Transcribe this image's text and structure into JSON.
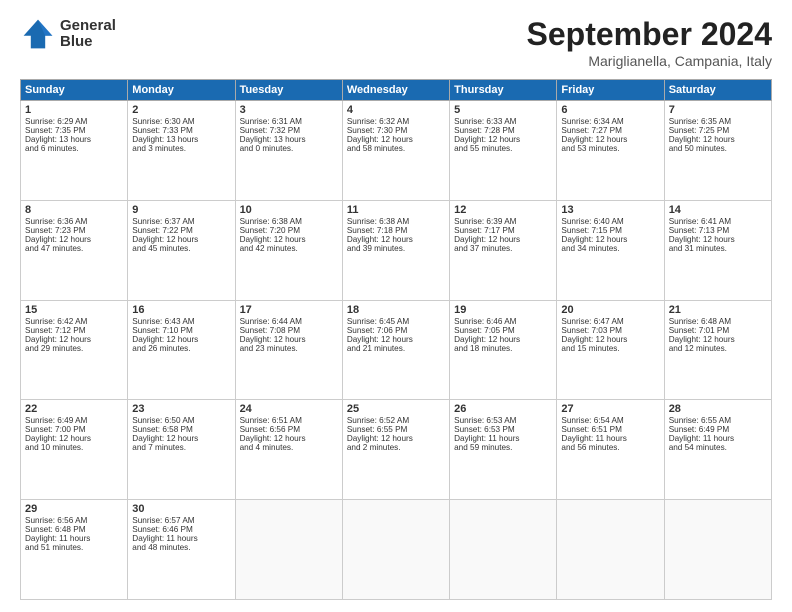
{
  "logo": {
    "line1": "General",
    "line2": "Blue"
  },
  "title": "September 2024",
  "location": "Mariglianella, Campania, Italy",
  "weekdays": [
    "Sunday",
    "Monday",
    "Tuesday",
    "Wednesday",
    "Thursday",
    "Friday",
    "Saturday"
  ],
  "weeks": [
    [
      {
        "day": "1",
        "info": "Sunrise: 6:29 AM\nSunset: 7:35 PM\nDaylight: 13 hours\nand 6 minutes."
      },
      {
        "day": "2",
        "info": "Sunrise: 6:30 AM\nSunset: 7:33 PM\nDaylight: 13 hours\nand 3 minutes."
      },
      {
        "day": "3",
        "info": "Sunrise: 6:31 AM\nSunset: 7:32 PM\nDaylight: 13 hours\nand 0 minutes."
      },
      {
        "day": "4",
        "info": "Sunrise: 6:32 AM\nSunset: 7:30 PM\nDaylight: 12 hours\nand 58 minutes."
      },
      {
        "day": "5",
        "info": "Sunrise: 6:33 AM\nSunset: 7:28 PM\nDaylight: 12 hours\nand 55 minutes."
      },
      {
        "day": "6",
        "info": "Sunrise: 6:34 AM\nSunset: 7:27 PM\nDaylight: 12 hours\nand 53 minutes."
      },
      {
        "day": "7",
        "info": "Sunrise: 6:35 AM\nSunset: 7:25 PM\nDaylight: 12 hours\nand 50 minutes."
      }
    ],
    [
      {
        "day": "8",
        "info": "Sunrise: 6:36 AM\nSunset: 7:23 PM\nDaylight: 12 hours\nand 47 minutes."
      },
      {
        "day": "9",
        "info": "Sunrise: 6:37 AM\nSunset: 7:22 PM\nDaylight: 12 hours\nand 45 minutes."
      },
      {
        "day": "10",
        "info": "Sunrise: 6:38 AM\nSunset: 7:20 PM\nDaylight: 12 hours\nand 42 minutes."
      },
      {
        "day": "11",
        "info": "Sunrise: 6:38 AM\nSunset: 7:18 PM\nDaylight: 12 hours\nand 39 minutes."
      },
      {
        "day": "12",
        "info": "Sunrise: 6:39 AM\nSunset: 7:17 PM\nDaylight: 12 hours\nand 37 minutes."
      },
      {
        "day": "13",
        "info": "Sunrise: 6:40 AM\nSunset: 7:15 PM\nDaylight: 12 hours\nand 34 minutes."
      },
      {
        "day": "14",
        "info": "Sunrise: 6:41 AM\nSunset: 7:13 PM\nDaylight: 12 hours\nand 31 minutes."
      }
    ],
    [
      {
        "day": "15",
        "info": "Sunrise: 6:42 AM\nSunset: 7:12 PM\nDaylight: 12 hours\nand 29 minutes."
      },
      {
        "day": "16",
        "info": "Sunrise: 6:43 AM\nSunset: 7:10 PM\nDaylight: 12 hours\nand 26 minutes."
      },
      {
        "day": "17",
        "info": "Sunrise: 6:44 AM\nSunset: 7:08 PM\nDaylight: 12 hours\nand 23 minutes."
      },
      {
        "day": "18",
        "info": "Sunrise: 6:45 AM\nSunset: 7:06 PM\nDaylight: 12 hours\nand 21 minutes."
      },
      {
        "day": "19",
        "info": "Sunrise: 6:46 AM\nSunset: 7:05 PM\nDaylight: 12 hours\nand 18 minutes."
      },
      {
        "day": "20",
        "info": "Sunrise: 6:47 AM\nSunset: 7:03 PM\nDaylight: 12 hours\nand 15 minutes."
      },
      {
        "day": "21",
        "info": "Sunrise: 6:48 AM\nSunset: 7:01 PM\nDaylight: 12 hours\nand 12 minutes."
      }
    ],
    [
      {
        "day": "22",
        "info": "Sunrise: 6:49 AM\nSunset: 7:00 PM\nDaylight: 12 hours\nand 10 minutes."
      },
      {
        "day": "23",
        "info": "Sunrise: 6:50 AM\nSunset: 6:58 PM\nDaylight: 12 hours\nand 7 minutes."
      },
      {
        "day": "24",
        "info": "Sunrise: 6:51 AM\nSunset: 6:56 PM\nDaylight: 12 hours\nand 4 minutes."
      },
      {
        "day": "25",
        "info": "Sunrise: 6:52 AM\nSunset: 6:55 PM\nDaylight: 12 hours\nand 2 minutes."
      },
      {
        "day": "26",
        "info": "Sunrise: 6:53 AM\nSunset: 6:53 PM\nDaylight: 11 hours\nand 59 minutes."
      },
      {
        "day": "27",
        "info": "Sunrise: 6:54 AM\nSunset: 6:51 PM\nDaylight: 11 hours\nand 56 minutes."
      },
      {
        "day": "28",
        "info": "Sunrise: 6:55 AM\nSunset: 6:49 PM\nDaylight: 11 hours\nand 54 minutes."
      }
    ],
    [
      {
        "day": "29",
        "info": "Sunrise: 6:56 AM\nSunset: 6:48 PM\nDaylight: 11 hours\nand 51 minutes."
      },
      {
        "day": "30",
        "info": "Sunrise: 6:57 AM\nSunset: 6:46 PM\nDaylight: 11 hours\nand 48 minutes."
      },
      {
        "day": "",
        "info": ""
      },
      {
        "day": "",
        "info": ""
      },
      {
        "day": "",
        "info": ""
      },
      {
        "day": "",
        "info": ""
      },
      {
        "day": "",
        "info": ""
      }
    ]
  ]
}
